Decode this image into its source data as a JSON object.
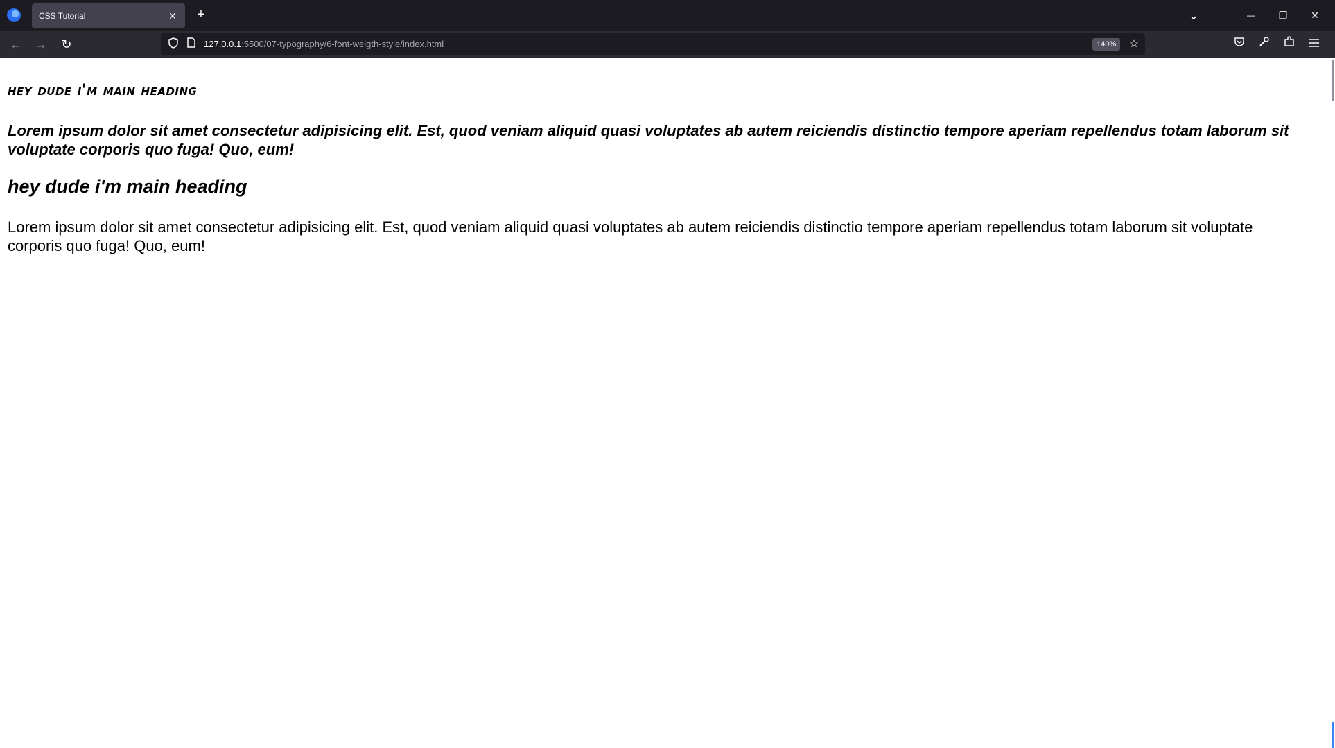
{
  "browser": {
    "tab": {
      "title": "CSS Tutorial",
      "close_glyph": "✕"
    },
    "new_tab_glyph": "+",
    "window_controls": {
      "list_tabs": "⌄",
      "minimize": "—",
      "restore": "❐",
      "close": "✕"
    },
    "nav": {
      "back": "←",
      "forward": "→",
      "reload": "↻"
    },
    "url": {
      "host": "127.0.0.1",
      "path": ":5500/07-typography/6-font-weigth-style/index.html"
    },
    "zoom": "140%",
    "icons": {
      "logo": "firefox-icon",
      "shield": "shield-icon",
      "page": "page-icon",
      "star": "star-icon",
      "pocket": "pocket-icon",
      "tools": "wrench-icon",
      "extensions": "puzzle-icon",
      "menu": "hamburger-icon"
    }
  },
  "page": {
    "heading_fancy": "hey dude i'm main heading",
    "paragraph_bold": "Lorem ipsum dolor sit amet consectetur adipisicing elit. Est, quod veniam aliquid quasi voluptates ab autem reiciendis distinctio tempore aperiam repellendus totam laborum sit voluptate corporis quo fuga! Quo, eum!",
    "heading_plain": "hey dude i'm main heading",
    "paragraph_plain": "Lorem ipsum dolor sit amet consectetur adipisicing elit. Est, quod veniam aliquid quasi voluptates ab autem reiciendis distinctio tempore aperiam repellendus totam laborum sit voluptate corporis quo fuga! Quo, eum!"
  }
}
